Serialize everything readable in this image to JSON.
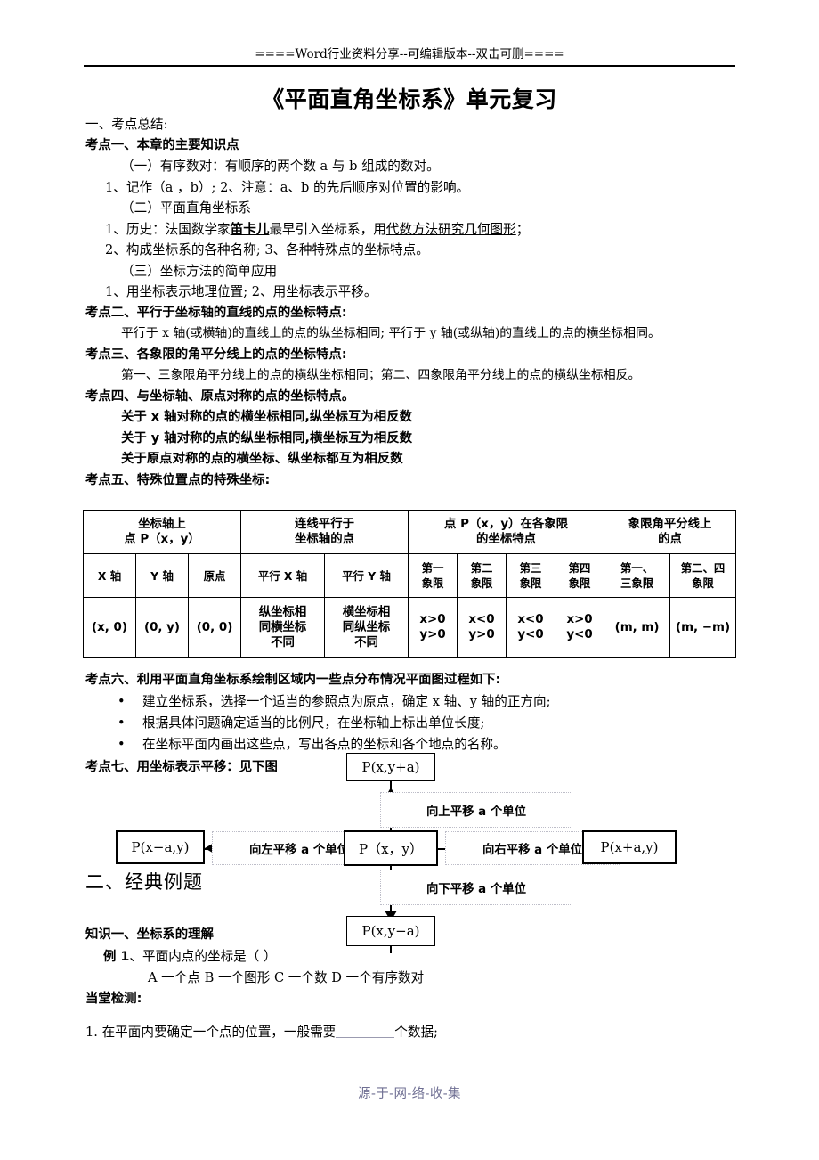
{
  "header": {
    "banner": "====Word行业资料分享--可编辑版本--双击可删===="
  },
  "title": "《平面直角坐标系》单元复习",
  "section_one": {
    "heading": "一、考点总结:",
    "kaodian1": {
      "heading": "考点一、本章的主要知识点",
      "l1": "（一）有序数对：有顺序的两个数 a 与 b 组成的数对。",
      "l2": "1、记作（a ，b）;      2、注意：a、b 的先后顺序对位置的影响。",
      "l3": "（二）平面直角坐标系",
      "l4_pre": "1、历史：法国数学家",
      "l4_b": "笛卡儿",
      "l4_mid": "最早引入坐标系，用",
      "l4_u": "代数方法研究几何图形",
      "l4_post": "；",
      "l5": "2、构成坐标系的各种名称;      3、各种特殊点的坐标特点。",
      "l6": "（三）坐标方法的简单应用",
      "l7": "1、用坐标表示地理位置;     2、用坐标表示平移。"
    },
    "kaodian2": {
      "heading": "考点二、平行于坐标轴的直线的点的坐标特点:",
      "body": "平行于 x 轴(或横轴)的直线上的点的纵坐标相同; 平行于 y 轴(或纵轴)的直线上的点的横坐标相同。"
    },
    "kaodian3": {
      "heading": "考点三、各象限的角平分线上的点的坐标特点:",
      "body": "第一、三象限角平分线上的点的横纵坐标相同；第二、四象限角平分线上的点的横纵坐标相反。"
    },
    "kaodian4": {
      "heading": "考点四、与坐标轴、原点对称的点的坐标特点。",
      "l1": "关于 x 轴对称的点的横坐标相同,纵坐标互为相反数",
      "l2": "关于 y 轴对称的点的纵坐标相同,横坐标互为相反数",
      "l3": "关于原点对称的点的横坐标、纵坐标都互为相反数"
    },
    "kaodian5": {
      "heading": "考点五、特殊位置点的特殊坐标:"
    },
    "kaodian6": {
      "heading": "考点六、利用平面直角坐标系绘制区域内一些点分布情况平面图过程如下:",
      "bullets": [
        "建立坐标系，选择一个适当的参照点为原点，确定 x 轴、y 轴的正方向;",
        "根据具体问题确定适当的比例尺，在坐标轴上标出单位长度;",
        "在坐标平面内画出这些点，写出各点的坐标和各个地点的名称。"
      ],
      "bullet_mark": "•"
    },
    "kaodian7": {
      "heading": "考点七、用坐标表示平移：见下图"
    }
  },
  "table": {
    "group_headers": [
      "坐标轴上\n点 P（x，y）",
      "连线平行于\n坐标轴的点",
      "点 P（x，y）在各象限\n的坐标特点",
      "象限角平分线上\n的点"
    ],
    "group_headers_l1": [
      "坐标轴上",
      "连线平行于",
      "点 P（x，y）在各象限",
      "象限角平分线上"
    ],
    "group_headers_l2": [
      "点 P（x，y）",
      "坐标轴的点",
      "的坐标特点",
      "的点"
    ],
    "sub_headers_l1": [
      "X 轴",
      "Y 轴",
      "原点",
      "平行 X 轴",
      "平行 Y 轴",
      "第一",
      "第二",
      "第三",
      "第四",
      "第一、",
      "第二、四"
    ],
    "sub_headers_l2": [
      "",
      "",
      "",
      "",
      "",
      "象限",
      "象限",
      "象限",
      "象限",
      "三象限",
      "象限"
    ],
    "values": [
      "(x, 0)",
      "(0, y)",
      "(0, 0)",
      "纵坐标相\n同横坐标\n不同",
      "横坐标相\n同纵坐标\n不同",
      "x>0\ny>0",
      "x<0\ny>0",
      "x<0\ny<0",
      "x>0\ny<0",
      "(m, m)",
      "(m, −m)"
    ],
    "values_lines": {
      "c4": [
        "纵坐标相",
        "同横坐标",
        "不同"
      ],
      "c5": [
        "横坐标相",
        "同纵坐标",
        "不同"
      ],
      "c6": [
        "x>0",
        "y>0"
      ],
      "c7": [
        "x<0",
        "y>0"
      ],
      "c8": [
        "x<0",
        "y<0"
      ],
      "c9": [
        "x>0",
        "y<0"
      ]
    }
  },
  "diagram": {
    "center": "P（x，y）",
    "up": "P(x,y+a)",
    "down": "P(x,y−a)",
    "left": "P(x−a,y)",
    "right": "P(x+a,y)",
    "label_up": "向上平移 a 个单位",
    "label_down": "向下平移 a 个单位",
    "label_left": "向左平移 a 个单位",
    "label_right": "向右平移 a 个单位"
  },
  "section_two": {
    "heading": "二、经典例题",
    "knowledge1": "知识一、坐标系的理解",
    "example1_label": "例 1",
    "example1": "、平面内点的坐标是（    ）",
    "options": "A   一个点    B     一个图形     C   一个数       D 一个有序数对",
    "quiz_heading": "当堂检测:",
    "q1_pre": "1. 在平面内要确定一个点的位置，一般需要",
    "q1_post": "个数据;"
  },
  "footer": {
    "text": "源-于-网-络-收-集"
  },
  "colors": {
    "text": "#000000",
    "footer": "#6f6f93",
    "label_border": "#bdbdc8"
  }
}
